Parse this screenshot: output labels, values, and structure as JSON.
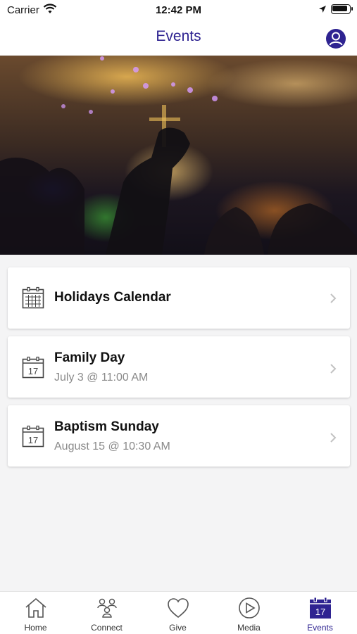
{
  "status_bar": {
    "carrier": "Carrier",
    "time": "12:42 PM"
  },
  "header": {
    "title": "Events"
  },
  "colors": {
    "accent": "#2e2391",
    "background": "#f4f4f5",
    "subtitle": "#8a8a8a"
  },
  "events": [
    {
      "title": "Holidays Calendar",
      "subtitle": "",
      "icon": "calendar-grid-icon"
    },
    {
      "title": "Family Day",
      "subtitle": "July 3 @ 11:00 AM",
      "icon": "calendar-day-icon",
      "day": "17"
    },
    {
      "title": "Baptism Sunday",
      "subtitle": "August 15 @ 10:30 AM",
      "icon": "calendar-day-icon",
      "day": "17"
    }
  ],
  "tab_bar": {
    "items": [
      {
        "label": "Home",
        "icon": "home-icon"
      },
      {
        "label": "Connect",
        "icon": "people-icon"
      },
      {
        "label": "Give",
        "icon": "heart-icon"
      },
      {
        "label": "Media",
        "icon": "play-icon"
      },
      {
        "label": "Events",
        "icon": "calendar-icon",
        "day": "17",
        "active": true
      }
    ]
  }
}
